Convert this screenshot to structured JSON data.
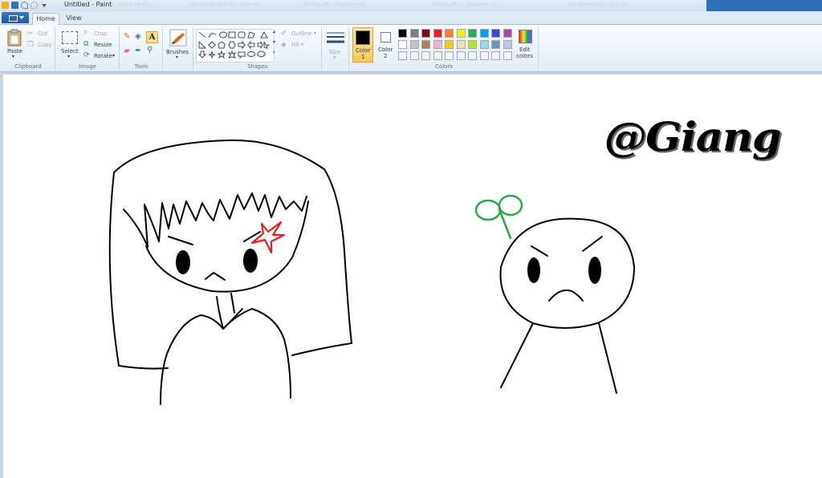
{
  "window": {
    "title": "Untitled - Paint"
  },
  "tabs": [
    {
      "label": "Home",
      "active": true
    },
    {
      "label": "View",
      "active": false
    }
  ],
  "background_tabs": [
    "Giang Ha Ha",
    "Đề gương cơ thiên - Giảo vọc",
    "Hỏi đáp 2H - Giang Ha Ha",
    "Hỏi đáp 2H7 - Giang Ha Ha",
    "Hỏi đáp mới tìm nhập 2H"
  ],
  "ribbon": {
    "clipboard": {
      "label": "Clipboard",
      "paste": "Paste",
      "cut": "Cut",
      "copy": "Copy"
    },
    "image": {
      "label": "Image",
      "select": "Select",
      "crop": "Crop",
      "resize": "Resize",
      "rotate": "Rotate"
    },
    "tools": {
      "label": "Tools"
    },
    "brushes": {
      "label": "Brushes"
    },
    "shapes": {
      "label": "Shapes",
      "outline": "Outline",
      "fill": "Fill"
    },
    "size": {
      "label": "Size"
    },
    "color1": {
      "label": "Color",
      "num": "1",
      "color": "#000000"
    },
    "color2": {
      "label": "Color",
      "num": "2",
      "color": "#ffffff"
    },
    "colors": {
      "label": "Colors",
      "edit": "Edit",
      "edit2": "colors"
    }
  },
  "palette": {
    "row1": [
      "#000000",
      "#7f7f7f",
      "#880015",
      "#ed1c24",
      "#ff7f27",
      "#fff200",
      "#22b14c",
      "#00a2e8",
      "#3f48cc",
      "#a349a4"
    ],
    "row2": [
      "#ffffff",
      "#c3c3c3",
      "#b97a57",
      "#ffaec9",
      "#ffc90e",
      "#efe4b0",
      "#b5e61d",
      "#99d9ea",
      "#7092be",
      "#c8bfe7"
    ],
    "row3": [
      "#f2f2f2",
      "#f2f2f2",
      "#f2f2f2",
      "#f2f2f2",
      "#f2f2f2",
      "#f2f2f2",
      "#f2f2f2",
      "#f2f2f2",
      "#f2f2f2",
      "#f2f2f2"
    ]
  },
  "canvas": {
    "signature": "@Giang"
  }
}
